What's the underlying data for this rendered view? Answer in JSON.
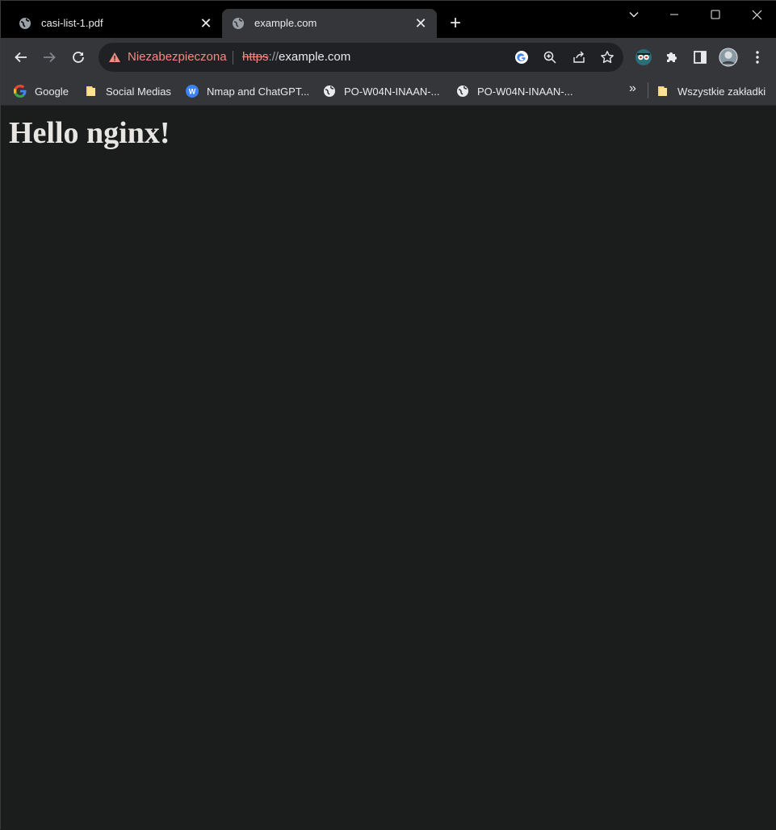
{
  "tabs": [
    {
      "title": "casi-list-1.pdf",
      "close": "✕"
    },
    {
      "title": "example.com",
      "close": "✕"
    }
  ],
  "new_tab": "+",
  "omnibox": {
    "security_text": "Niezabezpieczona",
    "url_scheme": "https",
    "url_separator": "://",
    "url_host": "example.com"
  },
  "bookmarks": [
    {
      "label": "Google",
      "icon": "google-icon"
    },
    {
      "label": "Social Medias",
      "icon": "folder-icon"
    },
    {
      "label": "Nmap and ChatGPT...",
      "icon": "w-icon"
    },
    {
      "label": "PO-W04N-INAAN-...",
      "icon": "globe-icon"
    },
    {
      "label": "PO-W04N-INAAN-...",
      "icon": "globe-icon"
    }
  ],
  "bookmarks_overflow": "»",
  "all_bookmarks": "Wszystkie zakładki",
  "page": {
    "heading": "Hello nginx!"
  },
  "colors": {
    "tabstrip": "#000000",
    "toolbar": "#35363a",
    "omnibox": "#202124",
    "insecure": "#f28b82",
    "page_bg": "#1b1c1c"
  }
}
